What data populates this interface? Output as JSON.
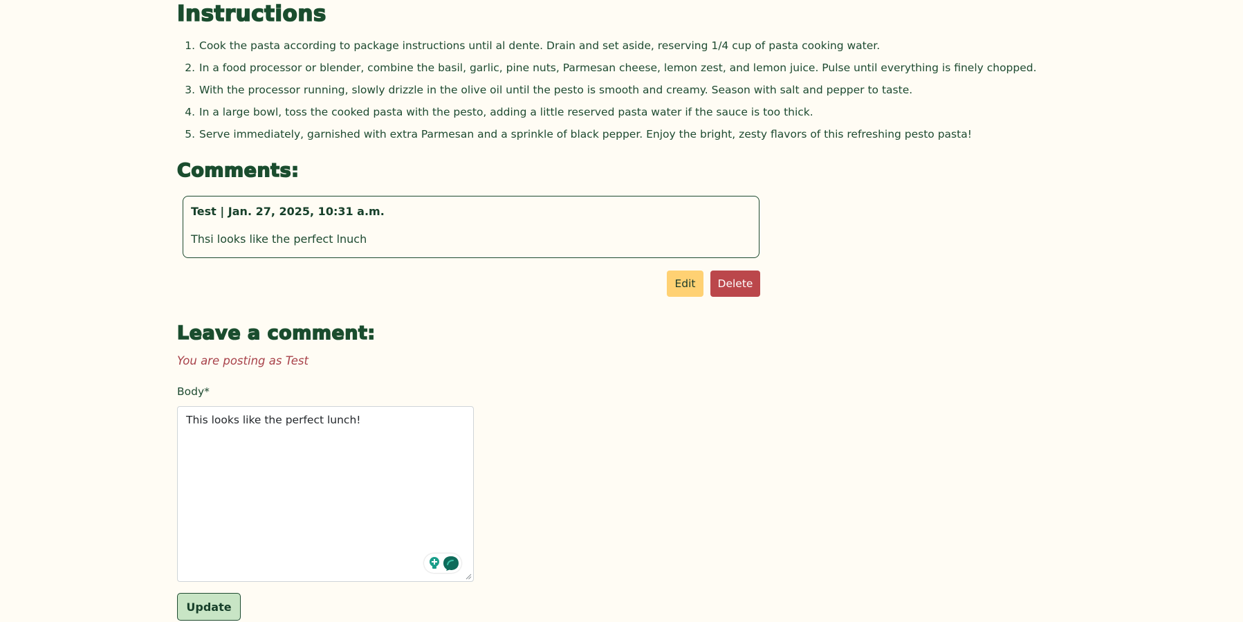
{
  "instructions": {
    "heading": "Instructions",
    "steps": [
      "Cook the pasta according to package instructions until al dente. Drain and set aside, reserving 1/4 cup of pasta cooking water.",
      "In a food processor or blender, combine the basil, garlic, pine nuts, Parmesan cheese, lemon zest, and lemon juice. Pulse until everything is finely chopped.",
      "With the processor running, slowly drizzle in the olive oil until the pesto is smooth and creamy. Season with salt and pepper to taste.",
      "In a large bowl, toss the cooked pasta with the pesto, adding a little reserved pasta water if the sauce is too thick.",
      "Serve immediately, garnished with extra Parmesan and a sprinkle of black pepper. Enjoy the bright, zesty flavors of this refreshing pesto pasta!"
    ]
  },
  "comments": {
    "heading": "Comments:",
    "items": [
      {
        "meta": "Test | Jan. 27, 2025, 10:31 a.m.",
        "body": "Thsi looks like the perfect lnuch"
      }
    ],
    "edit_label": "Edit",
    "delete_label": "Delete"
  },
  "comment_form": {
    "heading": "Leave a comment:",
    "posting_as": "You are posting as Test",
    "body_label": "Body*",
    "body_value": "This looks like the perfect lunch!",
    "submit_label": "Update",
    "assist_icons": [
      "lightbulb-plus-icon",
      "speech-bubble-icon"
    ]
  },
  "colors": {
    "background": "#fffcf4",
    "heading": "#1a4d2e",
    "text": "#1d4a30",
    "edit_button": "#ffd173",
    "delete_button": "#bb474b",
    "posting_as": "#a8424a",
    "update_button": "#c8e5c5",
    "assist_accent": "#1a9e8a"
  }
}
